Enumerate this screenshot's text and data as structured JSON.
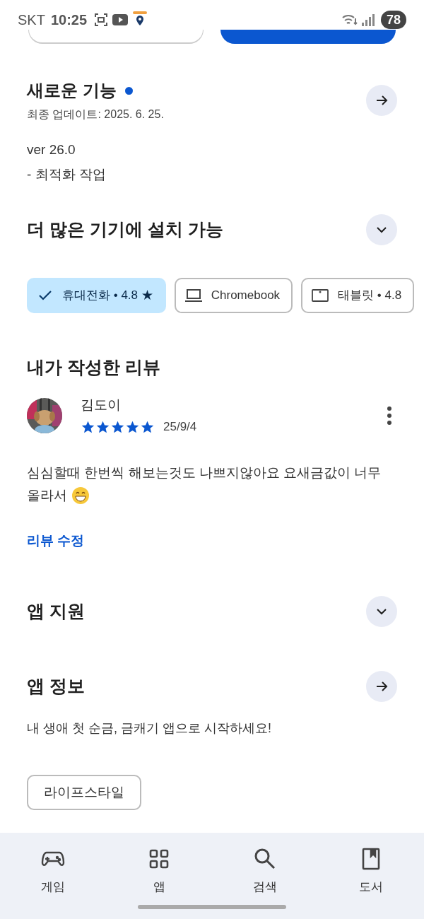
{
  "status_bar": {
    "carrier": "SKT",
    "time": "10:25",
    "battery": "78"
  },
  "whats_new": {
    "title": "새로운 기능",
    "date": "최종 업데이트: 2025. 6. 25.",
    "notes": [
      "ver 26.0",
      "- 최적화 작업"
    ]
  },
  "devices": {
    "title": "더 많은 기기에 설치 가능",
    "expanded": false,
    "chips": [
      {
        "kind": "phone",
        "label": "휴대전화 • 4.8 ★",
        "selected": true
      },
      {
        "kind": "laptop",
        "label": "Chromebook",
        "selected": false
      },
      {
        "kind": "tablet",
        "label": "태블릿 • 4.8",
        "selected": false
      }
    ]
  },
  "my_review": {
    "title": "내가 작성한 리뷰",
    "author": "김도이",
    "stars": 5,
    "date": "25/9/4",
    "text_lines": [
      "심심할때 한번씩 해보는것도 나쁘지않아요 요새금값이 너무",
      "올라서"
    ],
    "edit_link": "리뷰 수정"
  },
  "app_support": {
    "title": "앱 지원",
    "expanded": false
  },
  "app_info": {
    "title": "앱 정보",
    "description": "내 생애 첫 순금, 금캐기 앱으로 시작하세요!",
    "tags": [
      "라이프스타일"
    ]
  },
  "bottom_nav": [
    {
      "kind": "games",
      "label": "게임"
    },
    {
      "kind": "apps",
      "label": "앱"
    },
    {
      "kind": "search",
      "label": "검색"
    },
    {
      "kind": "books",
      "label": "도서"
    }
  ]
}
